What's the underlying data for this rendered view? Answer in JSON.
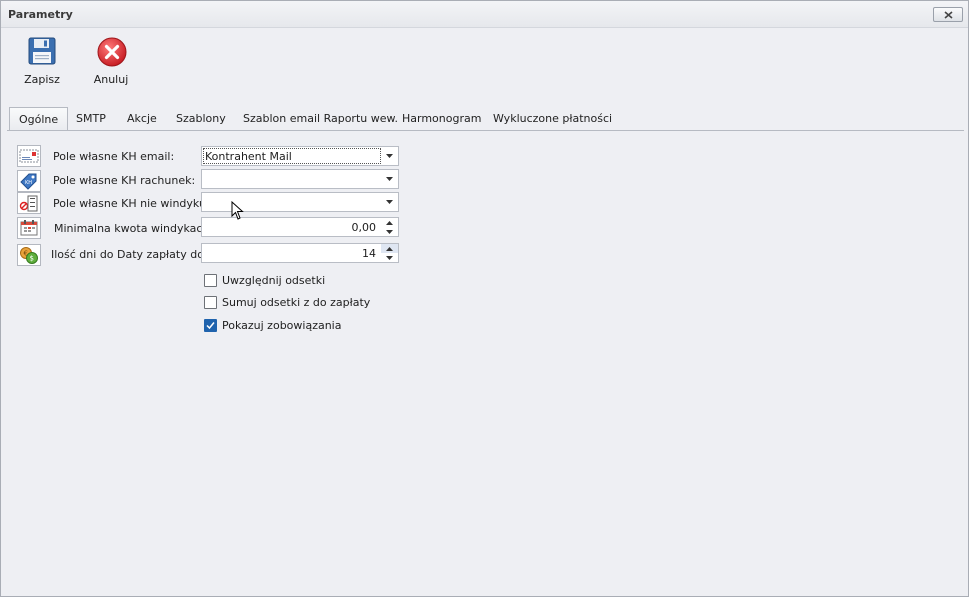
{
  "window": {
    "title": "Parametry"
  },
  "toolbar": {
    "save_label": "Zapisz",
    "cancel_label": "Anuluj"
  },
  "tabs": [
    {
      "label": "Ogólne",
      "active": true
    },
    {
      "label": "SMTP"
    },
    {
      "label": "Akcje"
    },
    {
      "label": "Szablony"
    },
    {
      "label": "Szablon email Raportu wew."
    },
    {
      "label": "Harmonogram"
    },
    {
      "label": "Wykluczone płatności"
    }
  ],
  "form": {
    "email": {
      "label": "Pole własne KH email:",
      "value": "Kontrahent Mail"
    },
    "account": {
      "label": "Pole własne KH rachunek:",
      "value": ""
    },
    "no_collect": {
      "label": "Pole własne KH nie windykuj:",
      "value": ""
    },
    "min_amount": {
      "label": "Minimalna kwota windykacji:",
      "value": "0,00"
    },
    "days": {
      "label": "Ilość dni do Daty zapłaty do:",
      "value": "14"
    }
  },
  "checkboxes": [
    {
      "label": "Uwzględnij odsetki",
      "checked": false
    },
    {
      "label": "Sumuj odsetki z do zapłaty",
      "checked": false
    },
    {
      "label": "Pokazuj zobowiązania",
      "checked": true
    }
  ],
  "colors": {
    "accent": "#1f63ad",
    "cancel_red": "#d9353a",
    "save_blue": "#3b6fb0"
  }
}
